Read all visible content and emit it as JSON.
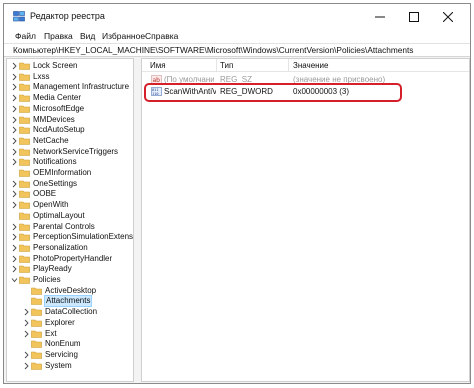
{
  "window": {
    "title": "Редактор реестра",
    "controls": {
      "minimize": "minimize-icon",
      "maximize": "maximize-icon",
      "close": "close-icon"
    }
  },
  "menu": {
    "items": [
      "Файл",
      "Правка",
      "Вид",
      "Избранное",
      "Справка"
    ]
  },
  "address": {
    "path": "Компьютер\\HKEY_LOCAL_MACHINE\\SOFTWARE\\Microsoft\\Windows\\CurrentVersion\\Policies\\Attachments"
  },
  "tree": {
    "items": [
      {
        "label": "Lock Screen",
        "expand": true
      },
      {
        "label": "Lxss",
        "expand": true
      },
      {
        "label": "Management Infrastructure",
        "expand": true
      },
      {
        "label": "Media Center",
        "expand": true
      },
      {
        "label": "MicrosoftEdge",
        "expand": true
      },
      {
        "label": "MMDevices",
        "expand": true
      },
      {
        "label": "NcdAutoSetup",
        "expand": true
      },
      {
        "label": "NetCache",
        "expand": true
      },
      {
        "label": "NetworkServiceTriggers",
        "expand": true
      },
      {
        "label": "Notifications",
        "expand": true
      },
      {
        "label": "OEMInformation",
        "expand": false
      },
      {
        "label": "OneSettings",
        "expand": true
      },
      {
        "label": "OOBE",
        "expand": true
      },
      {
        "label": "OpenWith",
        "expand": true
      },
      {
        "label": "OptimalLayout",
        "expand": false
      },
      {
        "label": "Parental Controls",
        "expand": true
      },
      {
        "label": "PerceptionSimulationExtension",
        "expand": true
      },
      {
        "label": "Personalization",
        "expand": true
      },
      {
        "label": "PhotoPropertyHandler",
        "expand": true
      },
      {
        "label": "PlayReady",
        "expand": true
      },
      {
        "label": "Policies",
        "expand": "open"
      },
      {
        "label": "ActiveDesktop",
        "expand": false,
        "child": true
      },
      {
        "label": "Attachments",
        "expand": false,
        "child": true,
        "selected": true
      },
      {
        "label": "DataCollection",
        "expand": true,
        "child": true
      },
      {
        "label": "Explorer",
        "expand": true,
        "child": true
      },
      {
        "label": "Ext",
        "expand": true,
        "child": true
      },
      {
        "label": "NonEnum",
        "expand": false,
        "child": true
      },
      {
        "label": "Servicing",
        "expand": true,
        "child": true
      },
      {
        "label": "System",
        "expand": true,
        "child": true
      }
    ]
  },
  "list": {
    "columns": [
      "Имя",
      "Тип",
      "Значение"
    ],
    "rows": [
      {
        "name": "(По умолчанию)",
        "type": "REG_SZ",
        "value": "(значение не присвоено)",
        "icon": "string-value-icon"
      },
      {
        "name": "ScanWithAntiVir...",
        "type": "REG_DWORD",
        "value": "0x00000003 (3)",
        "icon": "dword-value-icon"
      }
    ]
  },
  "colors": {
    "highlight": "#d3202b",
    "folder": "#f2c55c",
    "selection": "#cce8ff"
  }
}
